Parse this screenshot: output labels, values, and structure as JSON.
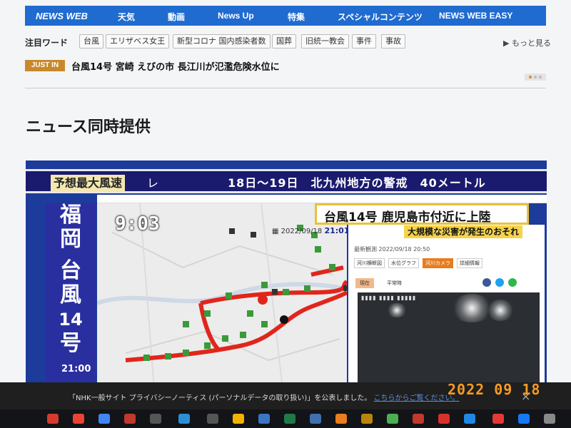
{
  "nav": {
    "items": [
      "NEWS WEB",
      "天気",
      "動画",
      "News Up",
      "特集",
      "スペシャルコンテンツ",
      "NEWS WEB EASY"
    ]
  },
  "keywords": {
    "label": "注目ワード",
    "items": [
      "台風",
      "エリザベス女王",
      "新型コロナ 国内感染者数",
      "国葬",
      "旧統一教会",
      "事件",
      "事故"
    ],
    "more": "もっと見る"
  },
  "just_in": {
    "badge": "JUST IN",
    "headline": "台風14号 宮崎 えびの市 長江川が氾濫危険水位に"
  },
  "section_title": "ニュース同時提供",
  "broadcast": {
    "forecast_label": "予想最大風速",
    "forecast_tail": "レ",
    "warning": "18日～19日　北九州地方の警戒　40メートル",
    "side_caption": [
      "福",
      "岡",
      "台",
      "風",
      "14",
      "号"
    ],
    "side_time": "21:00",
    "map_clock": "9:03",
    "map_date": "2022/09/18",
    "map_date_time": "21:01",
    "headline": "台風14号 鹿児島市付近に上陸",
    "sub_banner": "大規模な災害が発生のおそれ",
    "panel_meta": "最新観測 2022/09/18 20:50",
    "tabs": [
      "河川横断図",
      "水位グラフ",
      "河川カメラ",
      "詳細情報"
    ],
    "segments": [
      "現在",
      "平常時"
    ]
  },
  "privacy": {
    "text": "「NHK一般サイト プライバシーノーティス (パーソナルデータの取り扱い)」を公表しました。",
    "link": "こちらからご覧ください。",
    "close": "×"
  },
  "photo_stamp": "2022 09 18",
  "colors": {
    "nav_blue": "#1f6bd0",
    "just_in": "#c8892b",
    "headline_border": "#e8c23a",
    "stamp": "#f59a24"
  }
}
